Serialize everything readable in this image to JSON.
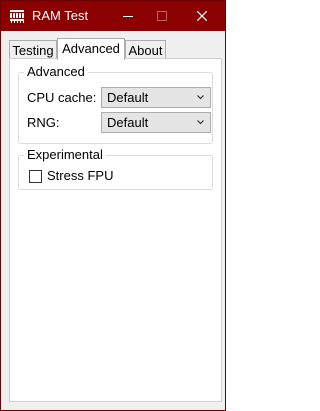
{
  "window": {
    "title": "RAM Test",
    "icon": "ram-test-app-icon",
    "title_bar_color": "#8b0000"
  },
  "tabs": [
    {
      "label": "Testing",
      "active": false
    },
    {
      "label": "Advanced",
      "active": true
    },
    {
      "label": "About",
      "active": false
    }
  ],
  "advanced_group": {
    "legend": "Advanced",
    "cpu_cache": {
      "label": "CPU cache:",
      "value": "Default"
    },
    "rng": {
      "label": "RNG:",
      "value": "Default"
    }
  },
  "experimental_group": {
    "legend": "Experimental",
    "stress_fpu": {
      "label": "Stress FPU",
      "checked": false
    }
  }
}
